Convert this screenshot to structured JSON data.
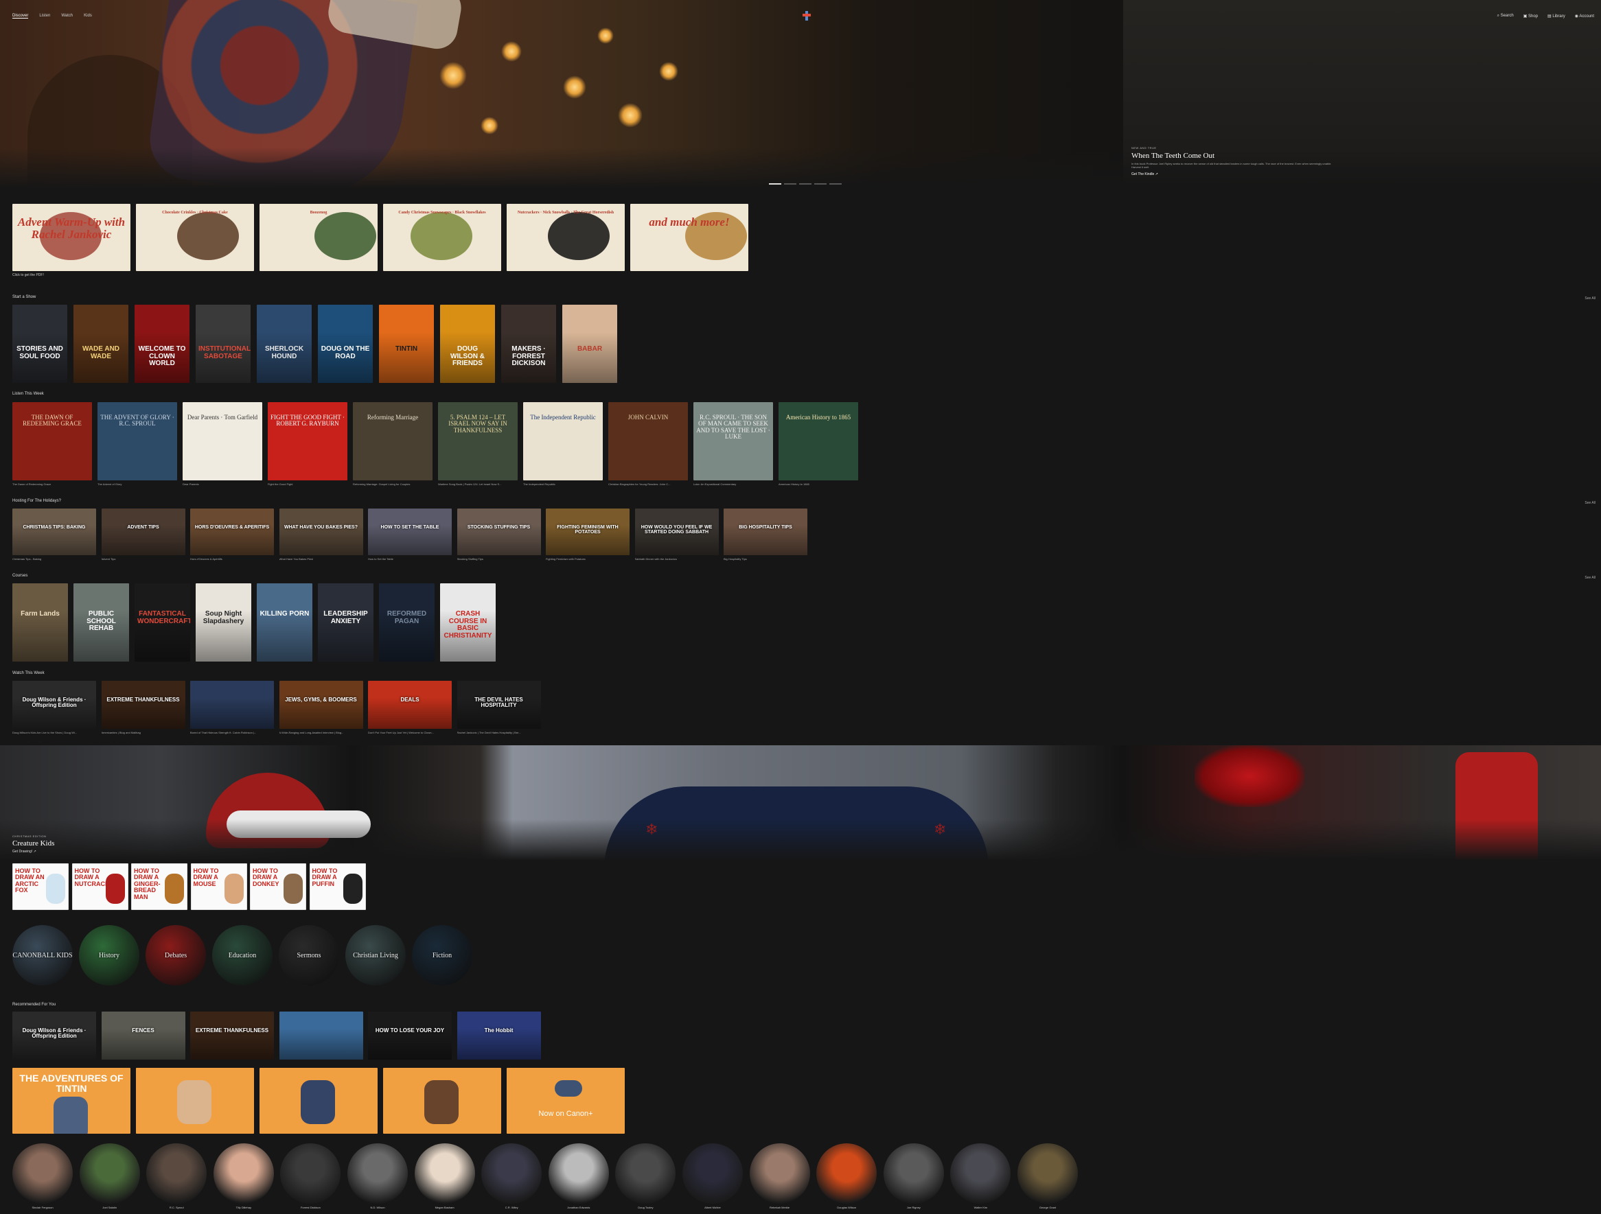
{
  "nav": {
    "left": [
      "Discover",
      "Listen",
      "Watch",
      "Kids"
    ],
    "right": [
      "Search",
      "Shop",
      "Library",
      "Account"
    ]
  },
  "hero": {
    "kicker": "NEW AND TRUE",
    "title": "When The Teeth Come Out",
    "description": "In this book Professor Joel Ripley seeks to recover the sense of old that steadied leaders in some tough calls. The race of the bravest. Even when seemingly unable. Harvest it well.",
    "cta": "Get The Kindle ↗",
    "slides_total": 5,
    "slide_active": 1
  },
  "advent": {
    "caption": "Click to get the PDF!",
    "tiles": [
      {
        "text": "Advent Warm-Up with Rachel Jankovic",
        "bg": "#efe6d3"
      },
      {
        "text": "Chocolate Crinkles · Christmas Cake",
        "bg": "#efe6d3"
      },
      {
        "text": "Boozenog",
        "bg": "#efe6d3"
      },
      {
        "text": "Candy Christmas Snowscapes · Black Snowflakes",
        "bg": "#efe6d3"
      },
      {
        "text": "Nutcrackers · Nick Snowballs · The Great Horseredish",
        "bg": "#efe6d3"
      },
      {
        "text": "and much more!",
        "bg": "#efe6d3"
      }
    ]
  },
  "shows": {
    "title": "Start a Show",
    "see_all": "See All",
    "items": [
      {
        "text": "STORIES AND SOUL FOOD",
        "bg": "#2a2d33",
        "fg": "#ffffff"
      },
      {
        "text": "WADE AND WADE",
        "bg": "#5a3418",
        "fg": "#f5d27a"
      },
      {
        "text": "WELCOME TO CLOWN WORLD",
        "bg": "#8c1414",
        "fg": "#ffffff"
      },
      {
        "text": "INSTITUTIONAL SABOTAGE",
        "bg": "#3a3a3a",
        "fg": "#e34a3a"
      },
      {
        "text": "SHERLOCK HOUND",
        "bg": "#2c4a6e",
        "fg": "#e8e8e8"
      },
      {
        "text": "DOUG ON THE ROAD",
        "bg": "#1d4f7a",
        "fg": "#ffffff"
      },
      {
        "text": "TINTIN",
        "bg": "#e36a1a",
        "fg": "#1a1a1a"
      },
      {
        "text": "DOUG WILSON & FRIENDS",
        "bg": "#d98e14",
        "fg": "#ffffff"
      },
      {
        "text": "MAKERS · FORREST DICKISON",
        "bg": "#3a2f2a",
        "fg": "#ffffff"
      },
      {
        "text": "BABAR",
        "bg": "#d8b596",
        "fg": "#b83a2a"
      }
    ]
  },
  "listen": {
    "title": "Listen This Week",
    "items": [
      {
        "text": "THE DAWN OF REDEEMING GRACE",
        "caption": "The Dawn of Redeeming Grace",
        "bg": "#8a1f16",
        "fg": "#f0d9b0"
      },
      {
        "text": "THE ADVENT OF GLORY · R.C. SPROUL",
        "caption": "The Advent of Glory",
        "bg": "#2d4a66",
        "fg": "#cfd9e6"
      },
      {
        "text": "Dear Parents · Tom Garfield",
        "caption": "Dear Parents",
        "bg": "#f0ebe0",
        "fg": "#333333"
      },
      {
        "text": "FIGHT THE GOOD FIGHT · ROBERT G. RAYBURN",
        "caption": "Fight the Good Fight",
        "bg": "#c8211b",
        "fg": "#ffffff"
      },
      {
        "text": "Reforming Marriage",
        "caption": "Reforming Marriage: Gospel Living for Couples",
        "bg": "#4a4032",
        "fg": "#e8e0cc"
      },
      {
        "text": "5. PSALM 124 – LET ISRAEL NOW SAY IN THANKFULNESS",
        "caption": "Wartime Song Book | Psalm 124: Let Israel Now S...",
        "bg": "#3e4a3a",
        "fg": "#e8d9a0"
      },
      {
        "text": "The Independent Republic",
        "caption": "The Independent Republic",
        "bg": "#e9e2d0",
        "fg": "#1e3a6e"
      },
      {
        "text": "JOHN CALVIN",
        "caption": "Christian Biographies for Young Readers: John C...",
        "bg": "#5a2f1c",
        "fg": "#e8d2a8"
      },
      {
        "text": "R.C. SPROUL · THE SON OF MAN CAME TO SEEK AND TO SAVE THE LOST · LUKE",
        "caption": "Luke: An Expositional Commentary",
        "bg": "#7b8a84",
        "fg": "#f2f2f2"
      },
      {
        "text": "American History to 1865",
        "caption": "American History to 1865",
        "bg": "#2a4a38",
        "fg": "#f5e6b0"
      }
    ]
  },
  "hosting": {
    "title": "Hosting For The Holidays?",
    "see_all": "See All",
    "items": [
      {
        "text": "CHRISTMAS TIPS: BAKING",
        "caption": "Christmas Tips - Baking",
        "bg": "#6a5a4a"
      },
      {
        "text": "ADVENT TIPS",
        "caption": "Advent Tips",
        "bg": "#4a3a30"
      },
      {
        "text": "HORS D'OEUVRES & APERITIFS",
        "caption": "Hors d'Oeuvres & Apéritifs",
        "bg": "#6a4a30"
      },
      {
        "text": "WHAT HAVE YOU BAKES PIES?",
        "caption": "What Have You Bakes Pies!",
        "bg": "#5a4a3a"
      },
      {
        "text": "HOW TO SET THE TABLE",
        "caption": "How to Set the Table",
        "bg": "#5a5a6a"
      },
      {
        "text": "STOCKING STUFFING TIPS",
        "caption": "Stocking Stuffing Tips",
        "bg": "#6a5a50"
      },
      {
        "text": "FIGHTING FEMINISM WITH POTATOES",
        "caption": "Fighting Feminism with Potatoes",
        "bg": "#7a5a2a"
      },
      {
        "text": "HOW WOULD YOU FEEL IF WE STARTED DOING SABBATH",
        "caption": "Sabbath Dinner with the Jankovics",
        "bg": "#3a3530"
      },
      {
        "text": "BIG HOSPITALITY TIPS",
        "caption": "Big Hospitality Tips",
        "bg": "#6a5040"
      }
    ]
  },
  "courses": {
    "title": "Courses",
    "see_all": "See All",
    "items": [
      {
        "text": "Farm Lands",
        "bg": "#6a5a42",
        "fg": "#f0e0c0"
      },
      {
        "text": "PUBLIC SCHOOL REHAB",
        "bg": "#6a7570",
        "fg": "#ffffff"
      },
      {
        "text": "FANTASTICAL WONDERCRAFT",
        "bg": "#1a1a1a",
        "fg": "#e34a3a"
      },
      {
        "text": "Soup Night Slapdashery",
        "bg": "#e8e4dc",
        "fg": "#222222"
      },
      {
        "text": "KILLING PORN",
        "bg": "#4a6a8a",
        "fg": "#ffffff"
      },
      {
        "text": "LEADERSHIP ANXIETY",
        "bg": "#2a2e38",
        "fg": "#ffffff"
      },
      {
        "text": "REFORMED PAGAN",
        "bg": "#1a2434",
        "fg": "#7a8aa0"
      },
      {
        "text": "CRASH COURSE IN BASIC CHRISTIANITY",
        "bg": "#e8e8e8",
        "fg": "#c8211b"
      }
    ]
  },
  "watch": {
    "title": "Watch This Week",
    "items": [
      {
        "text": "Doug Wilson & Friends · Offspring Edition",
        "caption": "Doug Wilson's Kids Are Live to the Show | Doug Wi...",
        "bg": "#2a2a2a"
      },
      {
        "text": "EXTREME THANKFULNESS",
        "caption": "Americanties | Blog and Mailbag",
        "bg": "#3a2416"
      },
      {
        "text": "",
        "caption": "Bored of That Hideous Strength ft. Calvin Robinson |...",
        "bg": "#2a3a5a"
      },
      {
        "text": "JEWS, GYMS, & BOOMERS",
        "caption": "A Wide-Ranging and Long-Awaited Interview | Blog...",
        "bg": "#6a3a1a"
      },
      {
        "text": "DEALS",
        "caption": "Don't Put Your Feet Up Just Yet | Welcome to Clown...",
        "bg": "#c0301a"
      },
      {
        "text": "THE DEVIL HATES HOSPITALITY",
        "caption": "Rachel Jankovic | The Devil Hates Hospitality | Bre...",
        "bg": "#1e1e1e"
      }
    ]
  },
  "kids": {
    "kicker": "CHRISTMAS EDITION",
    "title": "Creature Kids",
    "cta": "Get Drawing! ↗",
    "items": [
      {
        "text": "HOW TO DRAW AN ARCTIC FOX"
      },
      {
        "text": "HOW TO DRAW A NUTCRACKER"
      },
      {
        "text": "HOW TO DRAW A GINGER-BREAD MAN"
      },
      {
        "text": "HOW TO DRAW A MOUSE"
      },
      {
        "text": "HOW TO DRAW A DONKEY"
      },
      {
        "text": "HOW TO DRAW A PUFFIN"
      }
    ]
  },
  "categories": [
    {
      "text": "CANONBALL KIDS",
      "bg": "#3a4a58"
    },
    {
      "text": "History",
      "bg": "#2e6a38"
    },
    {
      "text": "Debates",
      "bg": "#8a1c1a"
    },
    {
      "text": "Education",
      "bg": "#2a4a3a"
    },
    {
      "text": "Sermons",
      "bg": "#2a2a2a"
    },
    {
      "text": "Christian Living",
      "bg": "#3a4a4a"
    },
    {
      "text": "Fiction",
      "bg": "#1a2a38"
    }
  ],
  "recommended": {
    "title": "Recommended For You",
    "items": [
      {
        "text": "Doug Wilson & Friends · Offspring Edition",
        "bg": "#2a2a2a"
      },
      {
        "text": "FENCES",
        "bg": "#5a5a52"
      },
      {
        "text": "EXTREME THANKFULNESS",
        "bg": "#3a2416"
      },
      {
        "text": "",
        "bg": "#3a6a9a"
      },
      {
        "text": "HOW TO LOSE YOUR JOY",
        "bg": "#1a1a1a"
      },
      {
        "text": "The Hobbit",
        "bg": "#2a3a7a"
      }
    ]
  },
  "tintin": {
    "items": [
      {
        "text": "THE ADVENTURES OF TINTIN"
      },
      {
        "text": ""
      },
      {
        "text": ""
      },
      {
        "text": ""
      },
      {
        "text": "Now on Canon+"
      }
    ]
  },
  "people": [
    "Sinclair Ferguson",
    "Joel Salatin",
    "R.C. Sproul",
    "Tilly Dillehay",
    "Forrest Dickison",
    "N.D. Wilson",
    "Megan Basham",
    "C.R. Wiley",
    "Jonathan Edwards",
    "Doug Tooley",
    "Albert Mohler",
    "Rebekah Merkle",
    "Douglas Wilson",
    "Joe Rigney",
    "Walter Kim",
    "George Grant"
  ],
  "colors": {
    "background": "#161616",
    "accent_orange": "#f0a040",
    "kids_red": "#c8211b"
  }
}
